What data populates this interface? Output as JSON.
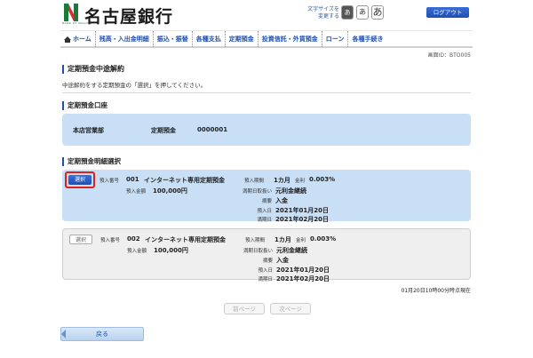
{
  "header": {
    "bank_name": "名古屋銀行",
    "logo_sub": "BANK OF NAGOYA",
    "fontsize_label": "文字サイズを\n変更する",
    "fontsize_small": "あ",
    "fontsize_mid": "あ",
    "fontsize_large": "あ",
    "logout": "ログアウト"
  },
  "nav": {
    "home": "ホーム",
    "items": [
      "残高・入出金明細",
      "振込・振替",
      "各種支払",
      "定期預金",
      "投資信託・外貨預金",
      "ローン",
      "各種手続き"
    ]
  },
  "screen_id": "画面ID：BTO005",
  "page": {
    "title": "定期預金中途解約",
    "instructions": "中途解約をする定期預金の「選択」を押してください。"
  },
  "account_section": {
    "title": "定期預金口座",
    "branch": "本店営業部",
    "type": "定期預金",
    "number": "0000001"
  },
  "detail_section": {
    "title": "定期預金明細選択",
    "labels": {
      "deposit_no": "預入番号",
      "amount": "預入金額",
      "period": "預入期間",
      "rate": "金利",
      "maturity_handling": "満期日取扱い",
      "tax": "摘要",
      "deposit_date": "預入日",
      "maturity_date": "満期日"
    },
    "select_label": "選択",
    "items": [
      {
        "deposit_no": "001",
        "product": "インターネット専用定期預金",
        "amount": "100,000円",
        "period": "1カ月",
        "rate": "0.003%",
        "maturity_handling": "元利金継続",
        "tax": "入金",
        "deposit_date": "2021年01月20日",
        "maturity_date": "2021年02月20日"
      },
      {
        "deposit_no": "002",
        "product": "インターネット専用定期預金",
        "amount": "100,000円",
        "period": "1カ月",
        "rate": "0.003%",
        "maturity_handling": "元利金継続",
        "tax": "入金",
        "deposit_date": "2021年01月20日",
        "maturity_date": "2021年02月20日"
      }
    ]
  },
  "timestamp": "01月20日10時00分時点現在",
  "pagination": {
    "prev": "前ページ",
    "next": "次ページ"
  },
  "back": "戻る",
  "colors": {
    "accent": "#1e4fb2",
    "panel": "#c9dff5",
    "highlight": "#e02020"
  }
}
